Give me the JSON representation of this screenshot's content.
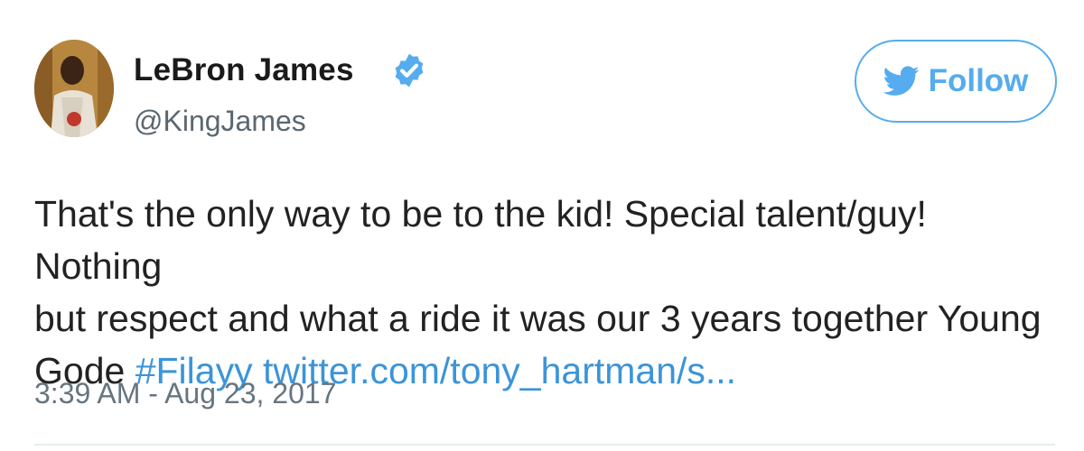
{
  "user": {
    "display_name": "LeBron James",
    "handle": "@KingJames",
    "verified": true,
    "avatar_icon": "profile-photo"
  },
  "follow_button": {
    "label": "Follow",
    "icon": "twitter-bird-icon",
    "color": "#55acee"
  },
  "tweet": {
    "text_line1": "That's the only way to be to the kid! Special talent/guy! Nothing",
    "text_line2": "but respect and what a ride it was our 3 years together Young",
    "text_line3_prefix": "Gode ",
    "hashtag": "#Filayy",
    "link": "twitter.com/tony_hartman/s...",
    "link_color": "#3b94d9"
  },
  "timestamp": "3:39 AM - Aug 23, 2017"
}
